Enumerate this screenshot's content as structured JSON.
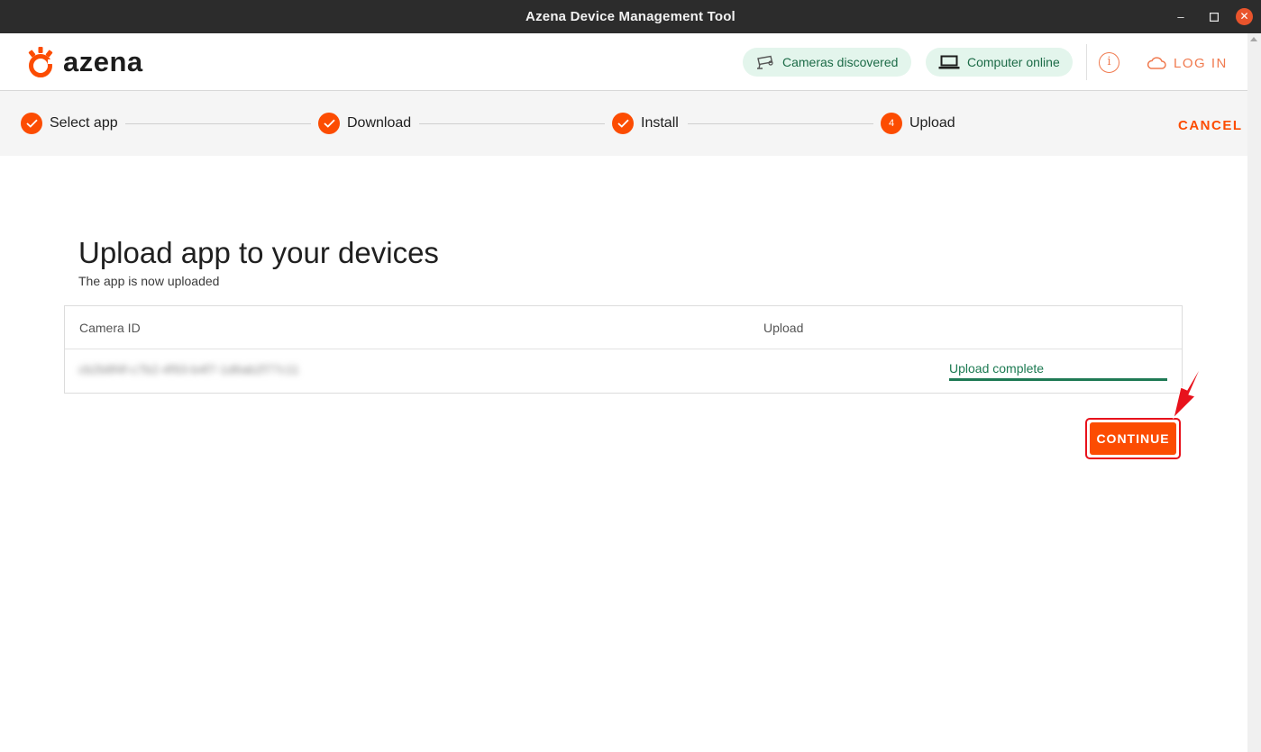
{
  "window": {
    "title": "Azena Device Management Tool",
    "controls": [
      "minimize-icon",
      "maximize-icon",
      "close-icon"
    ]
  },
  "header": {
    "logo_text": "azena",
    "chips": [
      {
        "label": "Cameras discovered",
        "icon": "camera-icon"
      },
      {
        "label": "Computer online",
        "icon": "laptop-icon"
      }
    ],
    "info_icon": "info-icon",
    "login_label": "LOG IN",
    "login_icon": "cloud-icon"
  },
  "stepper": {
    "steps": [
      {
        "label": "Select app",
        "state": "done"
      },
      {
        "label": "Download",
        "state": "done"
      },
      {
        "label": "Install",
        "state": "done"
      },
      {
        "label": "Upload",
        "state": "active",
        "number": "4"
      }
    ],
    "cancel_label": "CANCEL"
  },
  "main": {
    "title": "Upload app to your devices",
    "subtitle": "The app is now uploaded",
    "table": {
      "columns": [
        "Camera ID",
        "Upload"
      ],
      "rows": [
        {
          "camera_id": "cb2b8f4f-c7b2-4f93-b4f7-1d6ab2f77c11",
          "status": "Upload complete",
          "progress": 1.0
        }
      ]
    },
    "continue_label": "CONTINUE"
  },
  "colors": {
    "brand": "#fc4c02",
    "success": "#1c7a52",
    "chip_bg": "#e3f5ec",
    "highlight": "#e8121c"
  }
}
